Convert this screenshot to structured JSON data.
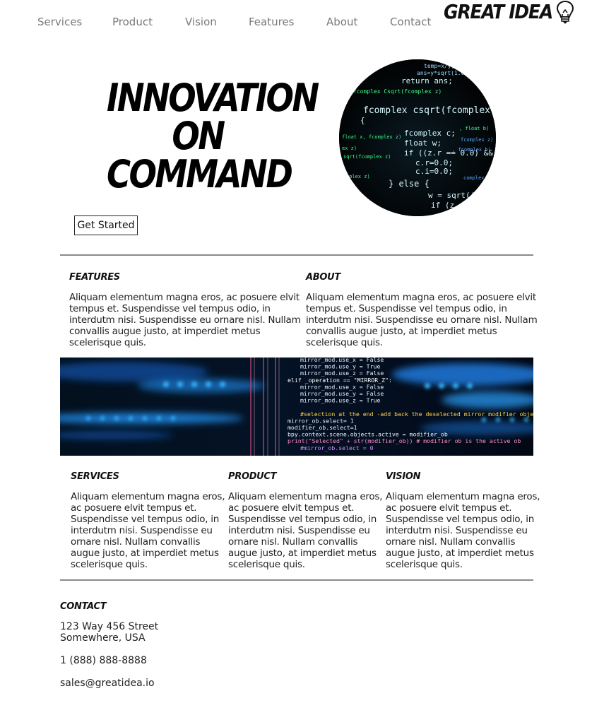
{
  "nav": {
    "items": [
      "Services",
      "Product",
      "Vision",
      "Features",
      "About",
      "Contact"
    ]
  },
  "logo": {
    "text": "GREAT IDEA",
    "icon": "lightbulb-icon"
  },
  "hero": {
    "title_lines": [
      "INNOVATION",
      "ON",
      "COMMAND"
    ],
    "cta_label": "Get Started",
    "image": "code-screen-circle"
  },
  "features": {
    "title": "FEATURES",
    "body": "Aliquam elementum magna eros, ac posuere elvit tempus et. Suspendisse vel tempus odio, in interdutm nisi. Suspendisse eu ornare nisl. Nullam convallis augue justo, at imperdiet metus scelerisque quis."
  },
  "about": {
    "title": "ABOUT",
    "body": "Aliquam elementum magna eros, ac posuere elvit tempus et. Suspendisse vel tempus odio, in interdutm nisi. Suspendisse eu ornare nisl. Nullam convallis augue justo, at imperdiet metus scelerisque quis."
  },
  "banner": {
    "image": "code-banner",
    "code_lines": [
      "mirror_mod.use_x = False",
      "mirror_mod.use_y = True",
      "mirror_mod.use_z = False",
      "elif _operation == \"MIRROR_Z\":",
      "mirror_mod.use_x = False",
      "mirror_mod.use_y = False",
      "mirror_mod.use_z = True",
      "",
      "#selection at the end -add back the deselected mirror modifier object",
      "mirror_ob.select= 1",
      "modifier_ob.select=1",
      "bpy.context.scene.objects.active = modifier_ob",
      "print(\"Selected\" + str(modifier_ob)) # modifier ob is the active ob",
      "#mirror_ob.select = 0"
    ]
  },
  "services": {
    "title": "SERVICES",
    "body": "Aliquam elementum magna eros, ac posuere elvit tempus et. Suspendisse vel tempus odio, in interdutm nisi. Suspendisse eu ornare nisl. Nullam convallis augue justo, at imperdiet metus scelerisque quis."
  },
  "product": {
    "title": "PRODUCT",
    "body": "Aliquam elementum magna eros, ac posuere elvit tempus et. Suspendisse vel tempus odio, in interdutm nisi. Suspendisse eu ornare nisl. Nullam convallis augue justo, at imperdiet metus scelerisque quis."
  },
  "vision": {
    "title": "VISION",
    "body": "Aliquam elementum magna eros, ac posuere elvit tempus et. Suspendisse vel tempus odio, in interdutm nisi. Suspendisse eu ornare nisl. Nullam convallis augue justo, at imperdiet metus scelerisque quis."
  },
  "contact": {
    "title": "CONTACT",
    "address_line1": "123 Way 456 Street",
    "address_line2": "Somewhere, USA",
    "phone": "1 (888) 888-8888",
    "email": "sales@greatidea.io"
  },
  "colors": {
    "nav_text": "#7a7a7a",
    "rule": "#8a8a8a",
    "code_green": "#3cff8a",
    "code_blue": "#1e90ff"
  }
}
